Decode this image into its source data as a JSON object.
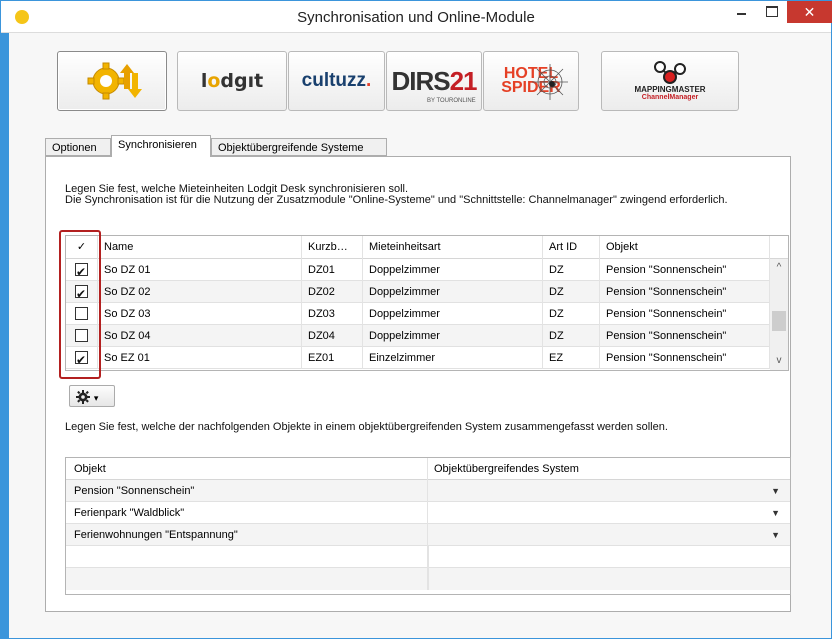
{
  "window": {
    "title": "Synchronisation und Online-Module",
    "close_glyph": "✕"
  },
  "toolbar": {
    "buttons": [
      {
        "id": "sync",
        "icon": "gear-sync-icon"
      },
      {
        "id": "lodgit",
        "label_a": "l",
        "label_o": "o",
        "label_b": "dgıt"
      },
      {
        "id": "cultuzz",
        "label": "cultuzz",
        "dot": "."
      },
      {
        "id": "dirs21",
        "label_a": "DIRS",
        "label_b": "21",
        "sub": "BY TOURONLINE"
      },
      {
        "id": "hotelspider",
        "label_a": "HOTEL",
        "label_b": "SPIDER"
      },
      {
        "id": "mappingmaster",
        "label_a": "MAPPINGMASTER",
        "label_b": "ChannelManager"
      }
    ]
  },
  "tabs": [
    {
      "label": "Optionen"
    },
    {
      "label": "Synchronisieren"
    },
    {
      "label": "Objektübergreifende Systeme"
    }
  ],
  "sync": {
    "intro_line1": "Legen Sie fest, welche Mieteinheiten Lodgit Desk synchronisieren soll.",
    "intro_line2": "Die Synchronisation ist für die Nutzung der Zusatzmodule \"Online-Systeme\" und \"Schnittstelle: Channelmanager\" zwingend erforderlich.",
    "columns": {
      "check": "✓",
      "name": "Name",
      "kurz": "Kurzb…",
      "art": "Mieteinheitsart",
      "artid": "Art ID",
      "objekt": "Objekt"
    },
    "rows": [
      {
        "checked": true,
        "name": "So DZ 01",
        "kurz": "DZ01",
        "art": "Doppelzimmer",
        "artid": "DZ",
        "objekt": "Pension \"Sonnenschein\""
      },
      {
        "checked": true,
        "name": "So DZ 02",
        "kurz": "DZ02",
        "art": "Doppelzimmer",
        "artid": "DZ",
        "objekt": "Pension \"Sonnenschein\""
      },
      {
        "checked": false,
        "name": "So DZ 03",
        "kurz": "DZ03",
        "art": "Doppelzimmer",
        "artid": "DZ",
        "objekt": "Pension \"Sonnenschein\""
      },
      {
        "checked": false,
        "name": "So DZ 04",
        "kurz": "DZ04",
        "art": "Doppelzimmer",
        "artid": "DZ",
        "objekt": "Pension \"Sonnenschein\""
      },
      {
        "checked": true,
        "name": "So EZ 01",
        "kurz": "EZ01",
        "art": "Einzelzimmer",
        "artid": "EZ",
        "objekt": "Pension \"Sonnenschein\""
      }
    ],
    "scroll_up": "^",
    "scroll_down": "v",
    "gear_button": {
      "icon": "gear-icon",
      "caret": "▾"
    }
  },
  "objects": {
    "intro": "Legen Sie fest, welche der nachfolgenden Objekte in einem objektübergreifenden System zusammengefasst werden sollen.",
    "columns": {
      "objekt": "Objekt",
      "system": "Objektübergreifendes System"
    },
    "rows": [
      {
        "objekt": "Pension \"Sonnenschein\"",
        "system": ""
      },
      {
        "objekt": "Ferienpark \"Waldblick\"",
        "system": ""
      },
      {
        "objekt": "Ferienwohnungen \"Entspannung\"",
        "system": ""
      }
    ],
    "dropdown_arrow": "▼"
  },
  "colors": {
    "accent": "#3b95db",
    "close": "#c7382f",
    "highlight": "#b32020"
  }
}
